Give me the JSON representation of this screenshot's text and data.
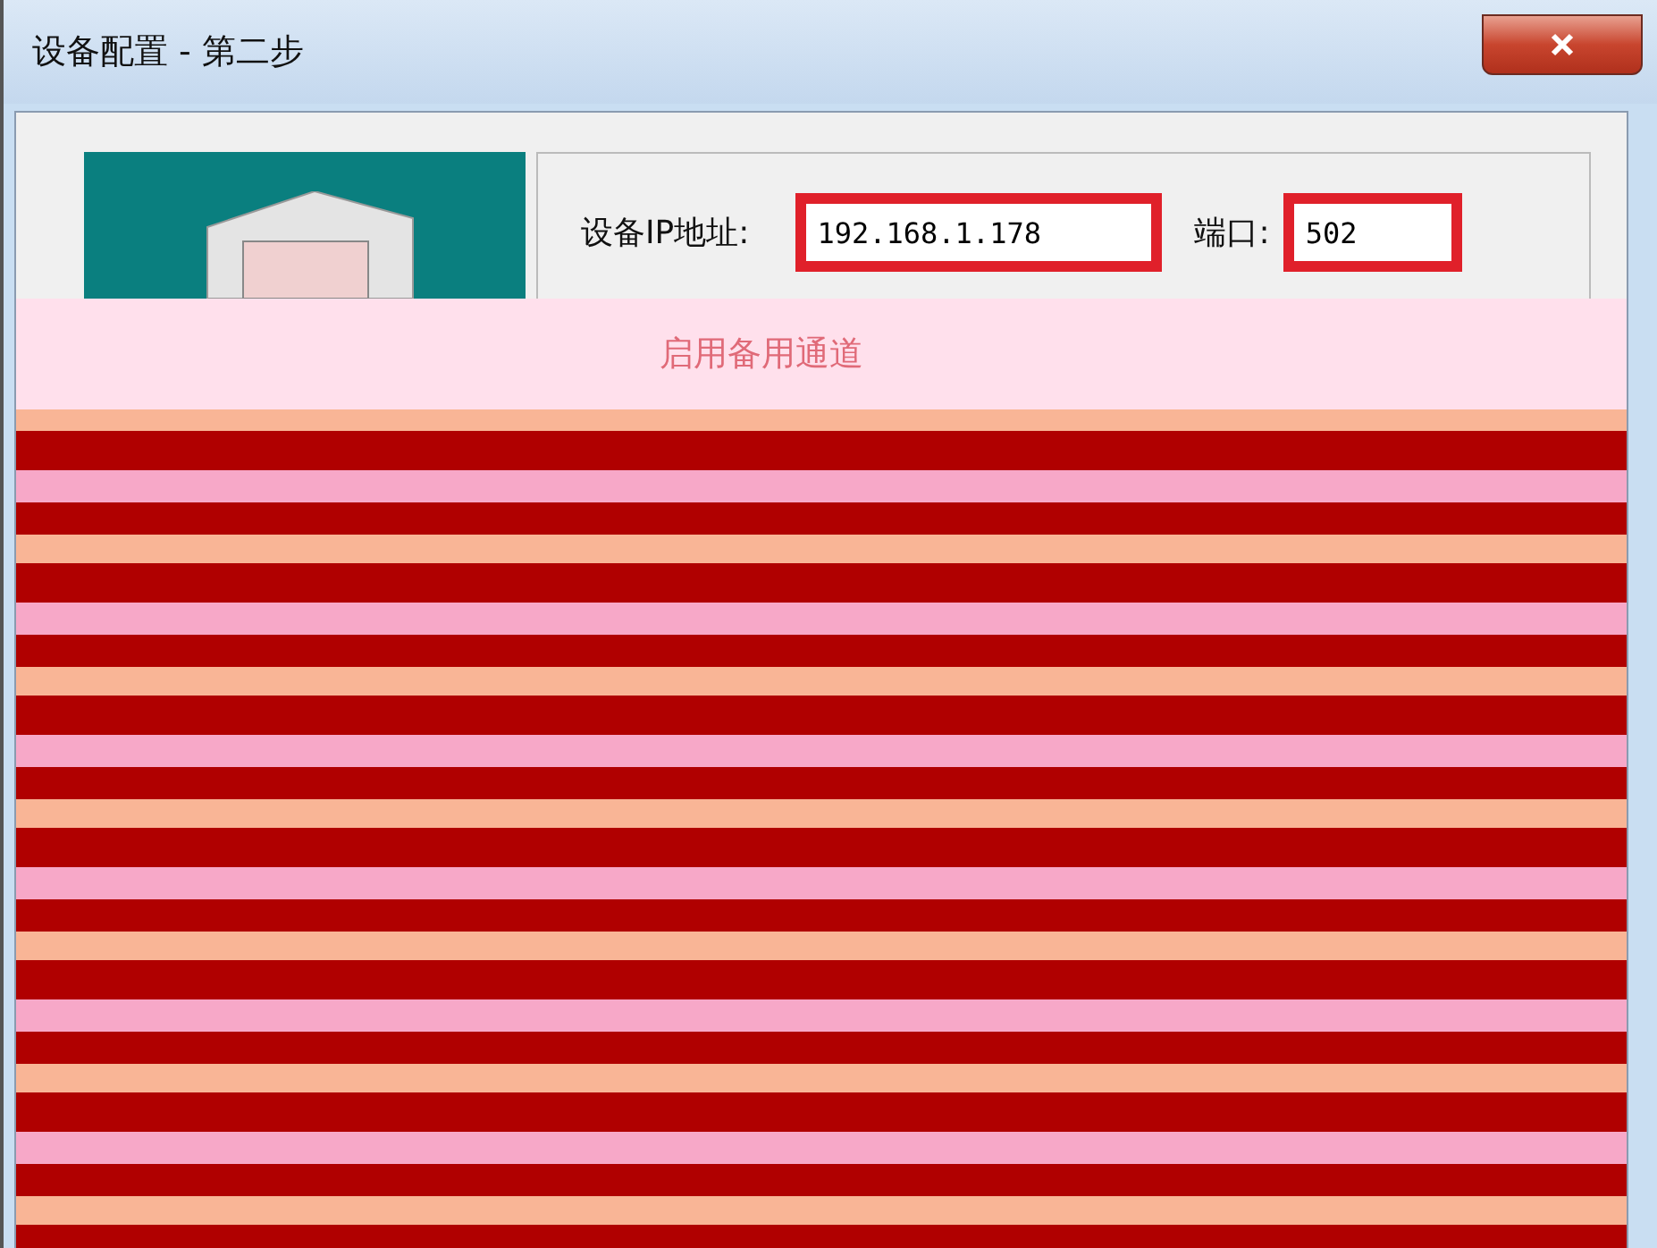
{
  "window": {
    "title": "设备配置 - 第二步"
  },
  "address": {
    "label": "设备IP地址:",
    "value": "192.168.1.178"
  },
  "port": {
    "label": "端口:",
    "value": "502"
  },
  "backup_channel": {
    "label": "启用备用通道"
  }
}
